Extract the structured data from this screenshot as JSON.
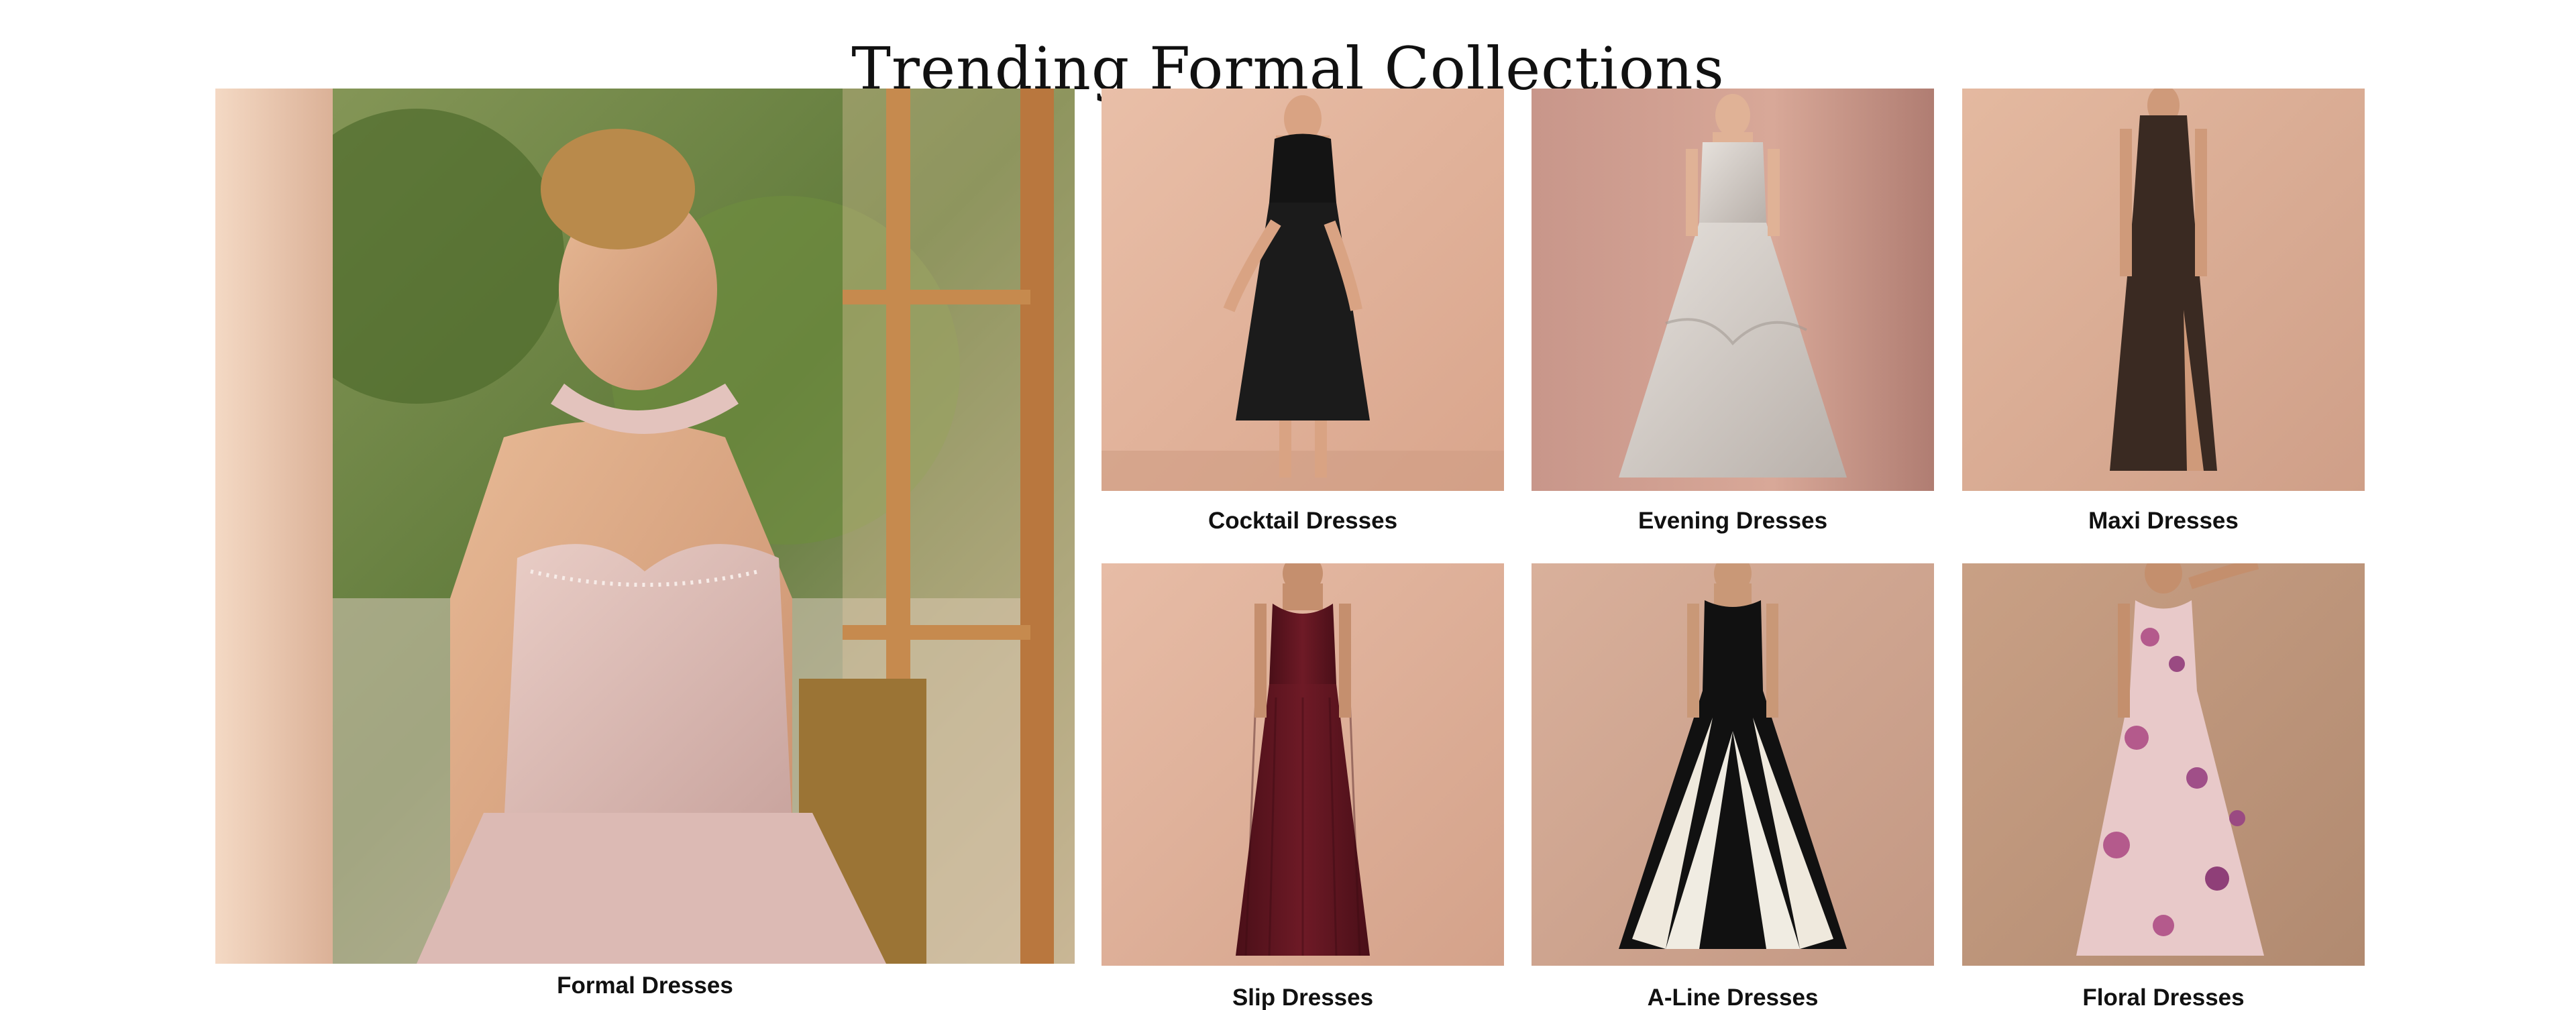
{
  "section": {
    "title": "Trending Formal Collections"
  },
  "collections": [
    {
      "label": "Formal Dresses"
    },
    {
      "label": "Cocktail Dresses"
    },
    {
      "label": "Evening Dresses"
    },
    {
      "label": "Maxi Dresses"
    },
    {
      "label": "Slip Dresses"
    },
    {
      "label": "A-Line Dresses"
    },
    {
      "label": "Floral Dresses"
    }
  ],
  "colors": {
    "backdrop_peach": "#e6b8a0",
    "backdrop_tan": "#c49b80",
    "formal_dress": "#d9b8b3",
    "cocktail_dress": "#141414",
    "evening_dress": "#cfc8c3",
    "maxi_dress": "#3a2a22",
    "slip_dress": "#5e1520",
    "aline_dress_dark": "#111111",
    "aline_dress_light": "#f0ece2",
    "floral_dress": "#e8c9c9"
  }
}
